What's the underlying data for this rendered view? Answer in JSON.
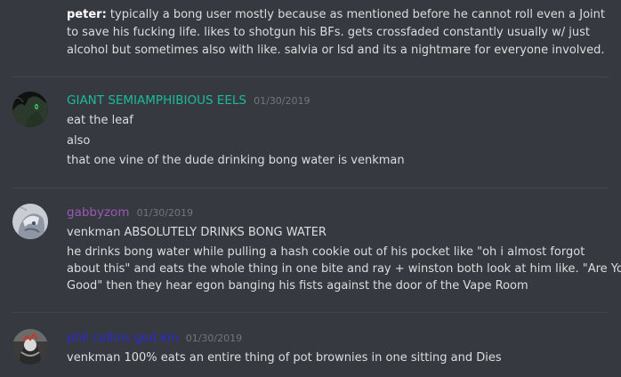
{
  "messages": [
    {
      "prefix": "peter:",
      "text": "typically a bong user mostly because as mentioned before he cannot roll even a Joint to save his fucking life. likes to shotgun his BFs. gets crossfaded constantly usually w/ just alcohol but sometimes also with like. salvia or lsd and its a nightmare for everyone involved."
    },
    {
      "username": "GIANT SEMIAMPHIBIOUS EELS",
      "username_color": "#1abc9c",
      "timestamp": "01/30/2019",
      "lines": [
        "eat the leaf",
        "also",
        "that one vine of the dude drinking bong water is venkman"
      ]
    },
    {
      "username": "gabbyzom",
      "username_color": "#9b59b6",
      "timestamp": "01/30/2019",
      "lines": [
        "venkman ABSOLUTELY DRINKS BONG WATER",
        "he drinks bong water while pulling a hash cookie out of his pocket like \"oh i almost forgot",
        "about this\" and eats the whole thing in one bite and ray + winston both look at him like. \"Are You",
        "Good\" then they hear egon banging his fists against the door of the Vape Room"
      ]
    },
    {
      "username": "phil collins god kin",
      "username_color": "#2a2ad8",
      "timestamp": "01/30/2019",
      "lines": [
        "venkman 100% eats an entire thing of pot brownies in one sitting and Dies"
      ]
    }
  ]
}
